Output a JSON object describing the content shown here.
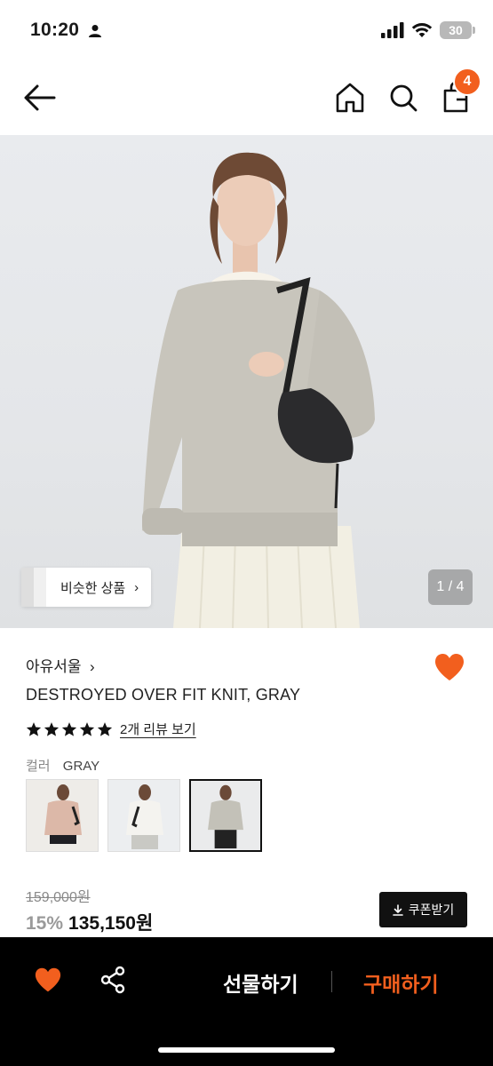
{
  "status_bar": {
    "time": "10:20",
    "battery": "30"
  },
  "nav": {
    "cart_count": "4"
  },
  "hero": {
    "similar_label": "비슷한 상품",
    "page_indicator": "1 / 4"
  },
  "product": {
    "brand": "아유서울",
    "title": "DESTROYED OVER FIT KNIT, GRAY",
    "rating_stars": 5,
    "review_link": "2개 리뷰 보기",
    "color_label": "컬러",
    "color_value": "GRAY",
    "swatches": [
      "pink",
      "white",
      "gray"
    ],
    "selected_swatch": "gray",
    "original_price": "159,000원",
    "discount": "15%",
    "sale_price": "135,150원",
    "coupon_label": "쿠폰받기"
  },
  "bottom_bar": {
    "gift_label": "선물하기",
    "buy_label": "구매하기"
  },
  "colors": {
    "accent": "#f25f1e",
    "dark": "#000000"
  },
  "icons": [
    "person-icon",
    "signal-icon",
    "wifi-icon",
    "battery-icon",
    "back-arrow-icon",
    "home-icon",
    "search-icon",
    "cart-icon",
    "heart-icon",
    "star-icon",
    "download-icon",
    "share-icon"
  ]
}
